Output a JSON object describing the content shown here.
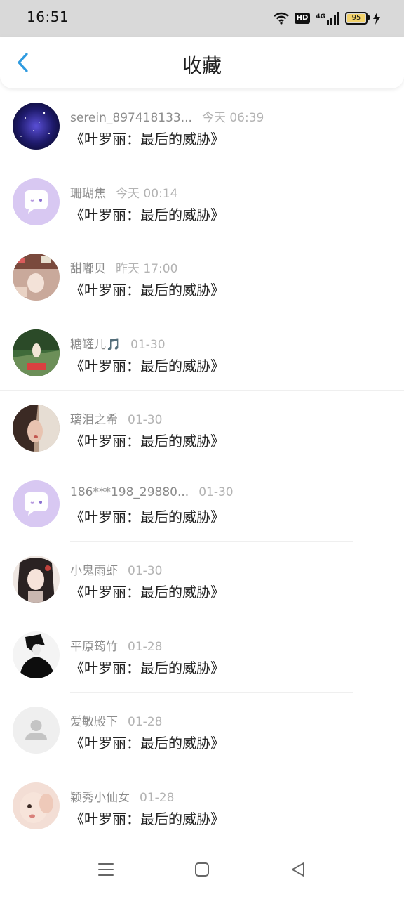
{
  "status_bar": {
    "time": "16:51",
    "battery": "95",
    "network": "4G",
    "hd": "HD"
  },
  "header": {
    "title": "收藏",
    "back_icon": "chevron-left-icon"
  },
  "colors": {
    "accent": "#2f9be0",
    "bot_avatar": "#d8c8f2",
    "status_bg": "#d9d9d9"
  },
  "items": [
    {
      "name": "serein_897418133...",
      "time": "今天 06:39",
      "content": "《叶罗丽：最后的威胁》",
      "avatar": "galaxy"
    },
    {
      "name": "珊瑚焦",
      "time": "今天 00:14",
      "content": "《叶罗丽：最后的威胁》",
      "avatar": "chat-bot"
    },
    {
      "name": "甜嘟贝",
      "time": "昨天 17:00",
      "content": "《叶罗丽：最后的威胁》",
      "avatar": "photo-warm"
    },
    {
      "name": "糖罐儿🎵",
      "time": "01-30",
      "content": "《叶罗丽：最后的威胁》",
      "avatar": "photo-green"
    },
    {
      "name": "璃泪之希",
      "time": "01-30",
      "content": "《叶罗丽：最后的威胁》",
      "avatar": "photo-face"
    },
    {
      "name": "186***198_29880...",
      "time": "01-30",
      "content": "《叶罗丽：最后的威胁》",
      "avatar": "chat-bot"
    },
    {
      "name": "小鬼雨虾",
      "time": "01-30",
      "content": "《叶罗丽：最后的威胁》",
      "avatar": "photo-anime"
    },
    {
      "name": "平原筠竹",
      "time": "01-28",
      "content": "《叶罗丽：最后的威胁》",
      "avatar": "photo-dark"
    },
    {
      "name": "爱敏殿下",
      "time": "01-28",
      "content": "《叶罗丽：最后的威胁》",
      "avatar": "default-user"
    },
    {
      "name": "颖秀小仙女",
      "time": "01-28",
      "content": "《叶罗丽：最后的威胁》",
      "avatar": "photo-baby"
    }
  ],
  "navbar": {
    "menu": "menu-icon",
    "home": "home-square-icon",
    "back": "back-triangle-icon"
  }
}
